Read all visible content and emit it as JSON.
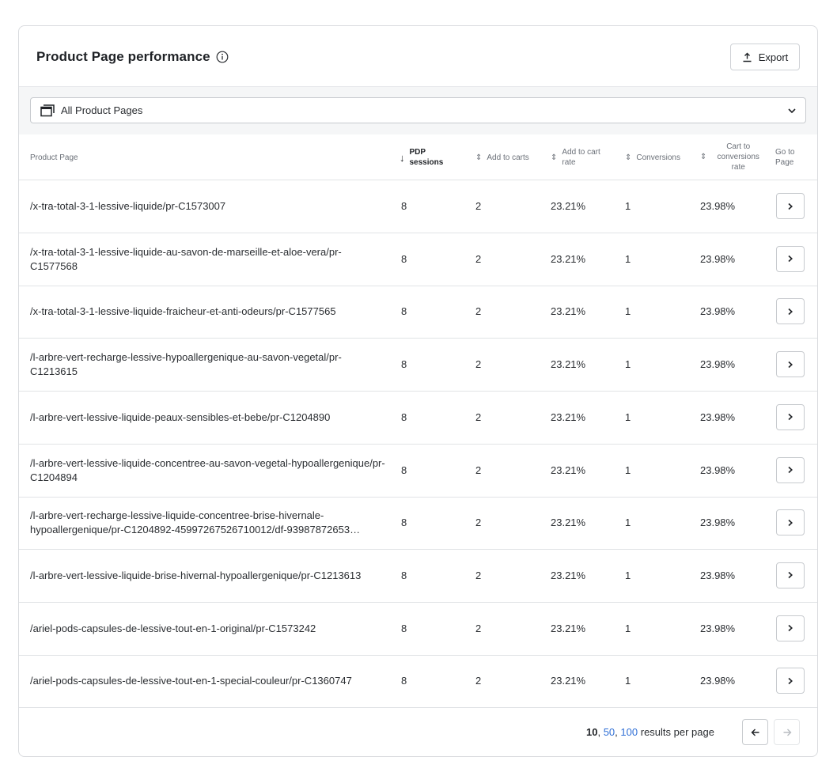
{
  "header": {
    "title": "Product Page performance",
    "export_label": "Export"
  },
  "filter": {
    "selected": "All Product Pages"
  },
  "table": {
    "columns": {
      "product_page": "Product Page",
      "pdp_sessions": "PDP sessions",
      "add_to_carts": "Add to carts",
      "add_to_cart_rate": "Add to cart rate",
      "conversions": "Conversions",
      "cart_to_conversions_rate": "Cart to conversions rate",
      "go_to_page": "Go to Page"
    },
    "sorted_column": "pdp_sessions",
    "sort_direction": "descending",
    "rows": [
      {
        "page": "/x-tra-total-3-1-lessive-liquide/pr-C1573007",
        "sessions": "8",
        "carts": "2",
        "rate": "23.21%",
        "conversions": "1",
        "cart_conv": "23.98%"
      },
      {
        "page": "/x-tra-total-3-1-lessive-liquide-au-savon-de-marseille-et-aloe-vera/pr-C1577568",
        "sessions": "8",
        "carts": "2",
        "rate": "23.21%",
        "conversions": "1",
        "cart_conv": "23.98%"
      },
      {
        "page": "/x-tra-total-3-1-lessive-liquide-fraicheur-et-anti-odeurs/pr-C1577565",
        "sessions": "8",
        "carts": "2",
        "rate": "23.21%",
        "conversions": "1",
        "cart_conv": "23.98%"
      },
      {
        "page": "/l-arbre-vert-recharge-lessive-hypoallergenique-au-savon-vegetal/pr-C1213615",
        "sessions": "8",
        "carts": "2",
        "rate": "23.21%",
        "conversions": "1",
        "cart_conv": "23.98%"
      },
      {
        "page": "/l-arbre-vert-lessive-liquide-peaux-sensibles-et-bebe/pr-C1204890",
        "sessions": "8",
        "carts": "2",
        "rate": "23.21%",
        "conversions": "1",
        "cart_conv": "23.98%"
      },
      {
        "page": "/l-arbre-vert-lessive-liquide-concentree-au-savon-vegetal-hypoallergenique/pr-C1204894",
        "sessions": "8",
        "carts": "2",
        "rate": "23.21%",
        "conversions": "1",
        "cart_conv": "23.98%"
      },
      {
        "page": "/l-arbre-vert-recharge-lessive-liquide-concentree-brise-hivernale-hypoallergenique/pr-C1204892-459972675267100​12/df-93987872653…",
        "sessions": "8",
        "carts": "2",
        "rate": "23.21%",
        "conversions": "1",
        "cart_conv": "23.98%"
      },
      {
        "page": "/l-arbre-vert-lessive-liquide-brise-hivernal-hypoallergenique/pr-C1213613",
        "sessions": "8",
        "carts": "2",
        "rate": "23.21%",
        "conversions": "1",
        "cart_conv": "23.98%"
      },
      {
        "page": "/ariel-pods-capsules-de-lessive-tout-en-1-original/pr-C1573242",
        "sessions": "8",
        "carts": "2",
        "rate": "23.21%",
        "conversions": "1",
        "cart_conv": "23.98%"
      },
      {
        "page": "/ariel-pods-capsules-de-lessive-tout-en-1-special-couleur/pr-C1360747",
        "sessions": "8",
        "carts": "2",
        "rate": "23.21%",
        "conversions": "1",
        "cart_conv": "23.98%"
      }
    ]
  },
  "pagination": {
    "options": [
      "10",
      "50",
      "100"
    ],
    "current": "10",
    "suffix": "results per page"
  },
  "colors": {
    "link": "#2f6fd6",
    "border": "#d9dbde",
    "band": "#f5f6f7"
  },
  "icons": {
    "info": "info-icon",
    "export": "upload-icon",
    "pages": "pages-icon",
    "dropdown": "chevron-down-icon",
    "sort": "sort-icon",
    "sort_active": "arrow-down-icon",
    "go": "chevron-right-icon",
    "prev": "arrow-left-icon",
    "next": "arrow-right-icon"
  }
}
